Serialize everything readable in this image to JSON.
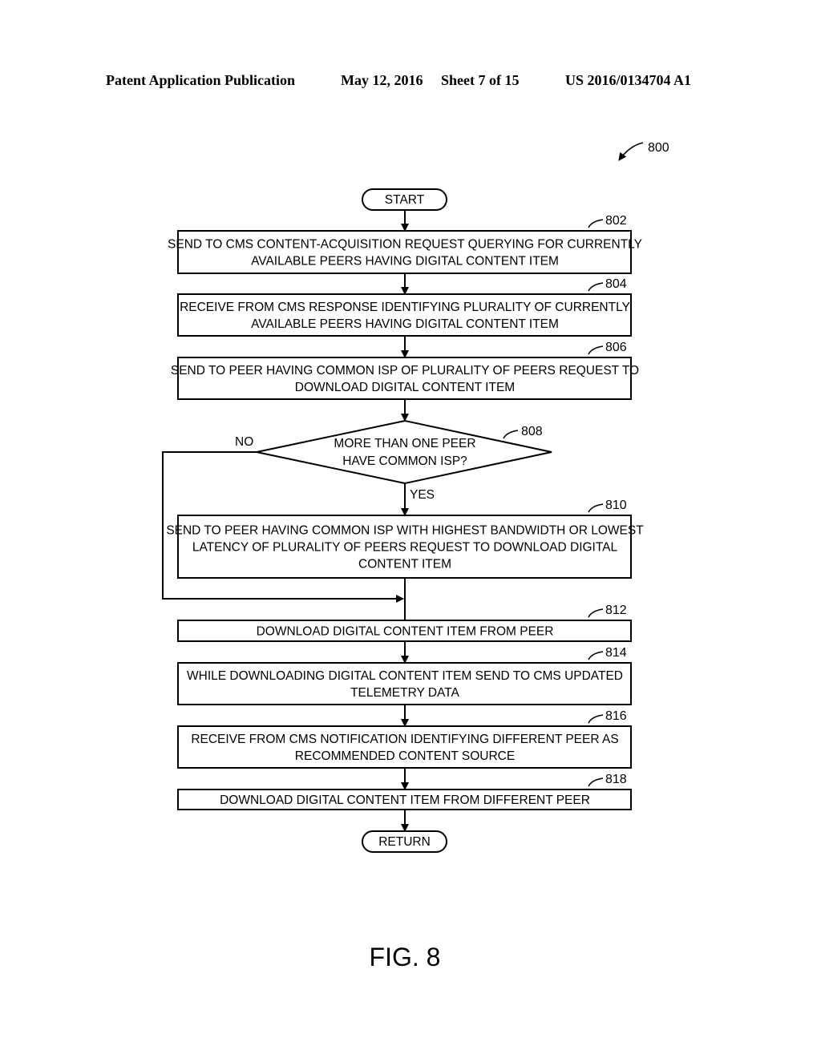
{
  "header": {
    "publication": "Patent Application Publication",
    "date": "May 12, 2016",
    "sheet": "Sheet 7 of 15",
    "number": "US 2016/0134704 A1"
  },
  "figure": {
    "ref": "800",
    "label": "FIG. 8"
  },
  "flow": {
    "start": "START",
    "end": "RETURN",
    "steps": [
      {
        "ref": "802",
        "lines": [
          "SEND TO CMS CONTENT-ACQUISITION REQUEST QUERYING FOR CURRENTLY",
          "AVAILABLE PEERS HAVING DIGITAL CONTENT ITEM"
        ]
      },
      {
        "ref": "804",
        "lines": [
          "RECEIVE FROM CMS RESPONSE IDENTIFYING PLURALITY OF CURRENTLY",
          "AVAILABLE PEERS HAVING DIGITAL CONTENT ITEM"
        ]
      },
      {
        "ref": "806",
        "lines": [
          "SEND TO PEER HAVING COMMON ISP OF PLURALITY OF PEERS REQUEST TO",
          "DOWNLOAD DIGITAL CONTENT ITEM"
        ]
      },
      {
        "ref": "810",
        "lines": [
          "SEND TO PEER HAVING COMMON ISP WITH HIGHEST BANDWIDTH OR LOWEST",
          "LATENCY OF PLURALITY OF PEERS REQUEST TO DOWNLOAD DIGITAL",
          "CONTENT ITEM"
        ]
      },
      {
        "ref": "812",
        "lines": [
          "DOWNLOAD DIGITAL CONTENT ITEM FROM PEER"
        ]
      },
      {
        "ref": "814",
        "lines": [
          "WHILE DOWNLOADING DIGITAL CONTENT ITEM SEND TO CMS UPDATED",
          "TELEMETRY DATA"
        ]
      },
      {
        "ref": "816",
        "lines": [
          "RECEIVE FROM CMS NOTIFICATION IDENTIFYING DIFFERENT PEER AS",
          "RECOMMENDED CONTENT SOURCE"
        ]
      },
      {
        "ref": "818",
        "lines": [
          "DOWNLOAD DIGITAL CONTENT ITEM FROM DIFFERENT PEER"
        ]
      }
    ],
    "decision": {
      "ref": "808",
      "lines": [
        "MORE THAN ONE PEER",
        "HAVE COMMON ISP?"
      ],
      "yes": "YES",
      "no": "NO"
    }
  }
}
